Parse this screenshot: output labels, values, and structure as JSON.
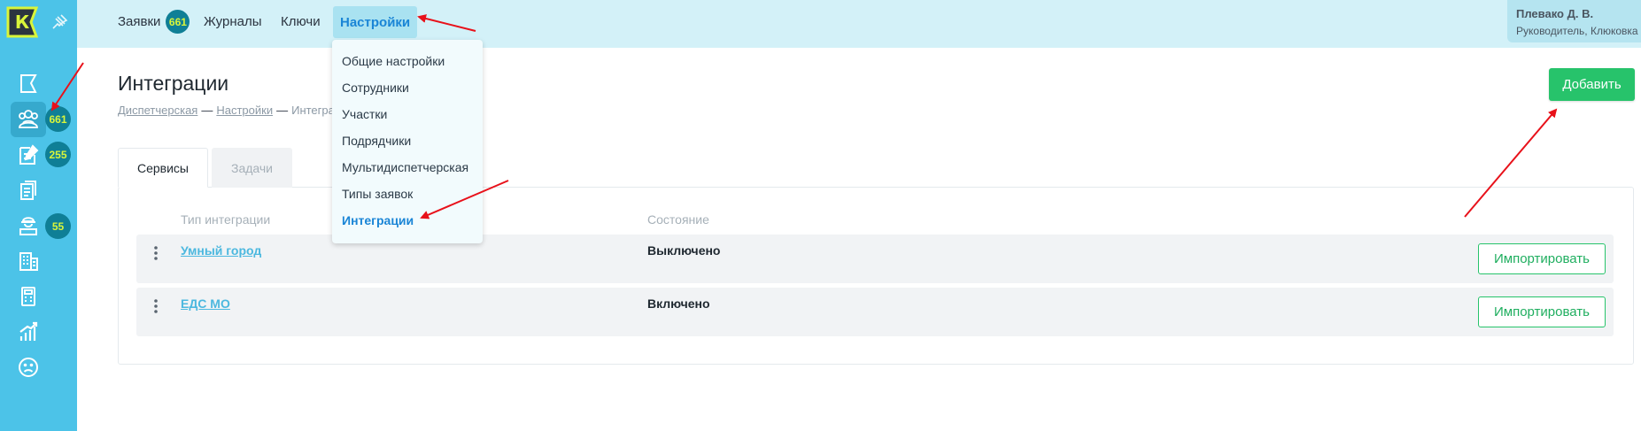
{
  "sidebar": {
    "logo_letter": "K",
    "items": [
      {
        "icon": "flag-icon"
      },
      {
        "icon": "people-icon",
        "badge": "661"
      },
      {
        "icon": "edit-document-icon",
        "badge": "255"
      },
      {
        "icon": "documents-icon"
      },
      {
        "icon": "worker-icon",
        "badge": "55"
      },
      {
        "icon": "building-icon"
      },
      {
        "icon": "calculator-icon"
      },
      {
        "icon": "chart-icon"
      },
      {
        "icon": "sad-face-icon"
      }
    ]
  },
  "topbar": {
    "tabs": [
      {
        "label": "Заявки",
        "badge": "661"
      },
      {
        "label": "Журналы"
      },
      {
        "label": "Ключи"
      },
      {
        "label": "Настройки",
        "active": true
      }
    ],
    "user_name": "Плевако Д. В.",
    "user_role": "Руководитель, Клюковка"
  },
  "dropdown": {
    "items": [
      "Общие настройки",
      "Сотрудники",
      "Участки",
      "Подрядчики",
      "Мультидиспетчерская",
      "Типы заявок",
      "Интеграции"
    ],
    "active_item": "Интеграции"
  },
  "page": {
    "title": "Интеграции",
    "breadcrumb": [
      "Диспетчерская",
      "Настройки",
      "Интеграции"
    ],
    "add_button": "Добавить"
  },
  "tabs": {
    "services": "Сервисы",
    "tasks": "Задачи"
  },
  "table": {
    "columns": [
      "Тип интеграции",
      "Состояние"
    ],
    "rows": [
      {
        "name": "Умный город",
        "state": "Выключено",
        "action": "Импортировать"
      },
      {
        "name": "ЕДС МО",
        "state": "Включено",
        "action": "Импортировать"
      }
    ]
  },
  "colors": {
    "sidebar": "#4cc3e8",
    "topbar": "#d3f1f8",
    "badge_bg": "#0f7f96",
    "badge_text": "#d9f53a",
    "accent_green": "#27c36b",
    "link_blue": "#4cb8df",
    "annotation_red": "#e8111a"
  }
}
